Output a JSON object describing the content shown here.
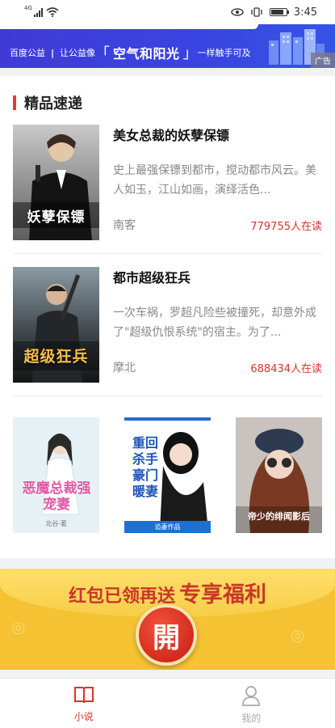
{
  "status_bar": {
    "network": "4G",
    "time": "3:45",
    "icons": [
      "signal-icon",
      "wifi-icon",
      "eye-icon",
      "vibrate-icon",
      "battery-icon"
    ]
  },
  "ad_banner": {
    "org": "百度公益",
    "divider": "|",
    "slogan_pre": "让公益像",
    "slogan_open": "「",
    "slogan_main": "空气和阳光",
    "slogan_close": "」",
    "slogan_post": "一样触手可及",
    "tag": "广告"
  },
  "section": {
    "title": "精品速递"
  },
  "books": [
    {
      "title": "美女总裁的妖孽保镖",
      "description": "史上最强保镖到都市，搅动都市风云。美人如玉，江山如画，演绎活色...",
      "author": "南客",
      "readers": "779755人在读",
      "cover_text": "妖孽保镖"
    },
    {
      "title": "都市超级狂兵",
      "description": "一次车祸，罗超凡险些被撞死，却意外成了\"超级仇恨系统\"的宿主。为了...",
      "author": "摩北",
      "readers": "688434人在读",
      "cover_text": "超级狂兵"
    }
  ],
  "thumbnails": [
    {
      "cover_text": "恶魔总裁强宠妻",
      "author_text": "北谷·著"
    },
    {
      "cover_text": "重回杀手豪门暖妻",
      "author_text": "追妻作品"
    },
    {
      "cover_text": "帝少的绯闻影后",
      "author_text": ""
    }
  ],
  "promo": {
    "text_plain": "红包已领再送",
    "text_bold": "专享福利",
    "button": "開"
  },
  "tabs": [
    {
      "label": "小说",
      "icon": "book-icon",
      "active": true
    },
    {
      "label": "我的",
      "icon": "user-icon",
      "active": false
    }
  ],
  "colors": {
    "accent": "#d9332b",
    "banner_blue": "#3a44e0",
    "promo_yellow": "#f4c232"
  }
}
